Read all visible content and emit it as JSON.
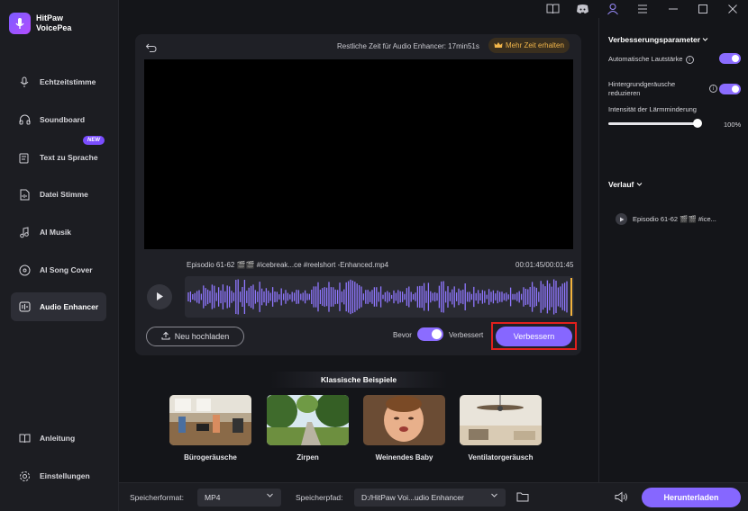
{
  "app": {
    "name_line1": "HitPaw",
    "name_line2": "VoicePea"
  },
  "sidebar": {
    "items": [
      {
        "label": "Echtzeitstimme",
        "icon": "microphone-icon"
      },
      {
        "label": "Soundboard",
        "icon": "headphones-icon"
      },
      {
        "label": "Text zu Sprache",
        "icon": "text-to-speech-icon",
        "badge": "NEW"
      },
      {
        "label": "Datei Stimme",
        "icon": "file-voice-icon"
      },
      {
        "label": "AI Musik",
        "icon": "music-note-icon"
      },
      {
        "label": "AI Song Cover",
        "icon": "disc-icon"
      },
      {
        "label": "Audio Enhancer",
        "icon": "audio-enhancer-icon",
        "active": true
      }
    ],
    "bottom": [
      {
        "label": "Anleitung",
        "icon": "book-icon"
      },
      {
        "label": "Einstellungen",
        "icon": "gear-icon"
      }
    ]
  },
  "topbar": {
    "icons": [
      "guide-book-icon",
      "discord-icon",
      "user-icon",
      "menu-icon",
      "minimize-icon",
      "maximize-icon",
      "close-icon"
    ]
  },
  "panel": {
    "remaining_text": "Restliche Zeit für Audio Enhancer: 17min51s",
    "more_time_label": "Mehr Zeit erhalten",
    "filename": "Episodio 61-62 🎬🎬 #icebreak...ce #reelshort -Enhanced.mp4",
    "timecode": "00:01:45/00:01:45",
    "upload_label": "Neu hochladen",
    "before_label": "Bevor",
    "after_label": "Verbessert",
    "compare_enabled": true,
    "enhance_label": "Verbessern"
  },
  "examples": {
    "title": "Klassische Beispiele",
    "items": [
      {
        "label": "Bürogeräusche"
      },
      {
        "label": "Zirpen"
      },
      {
        "label": "Weinendes Baby"
      },
      {
        "label": "Ventilatorgeräusch"
      }
    ]
  },
  "bottombar": {
    "format_label": "Speicherformat:",
    "format_value": "MP4",
    "path_label": "Speicherpfad:",
    "path_value": "D:/HitPaw Voi...udio Enhancer",
    "download_label": "Herunterladen"
  },
  "right_panel": {
    "params_title": "Verbesserungsparameter",
    "auto_volume_label": "Automatische Lautstärke",
    "auto_volume_on": true,
    "noise_reduce_label": "Hintergrundgeräusche reduzieren",
    "noise_reduce_on": true,
    "intensity_label": "Intensität der Lärmminderung",
    "intensity_value": "100%",
    "history_title": "Verlauf",
    "history_item": "Episodio 61-62 🎬🎬 #ice..."
  },
  "colors": {
    "accent": "#8667ff",
    "highlight_border": "#e0201d",
    "gold": "#f1b54a"
  }
}
